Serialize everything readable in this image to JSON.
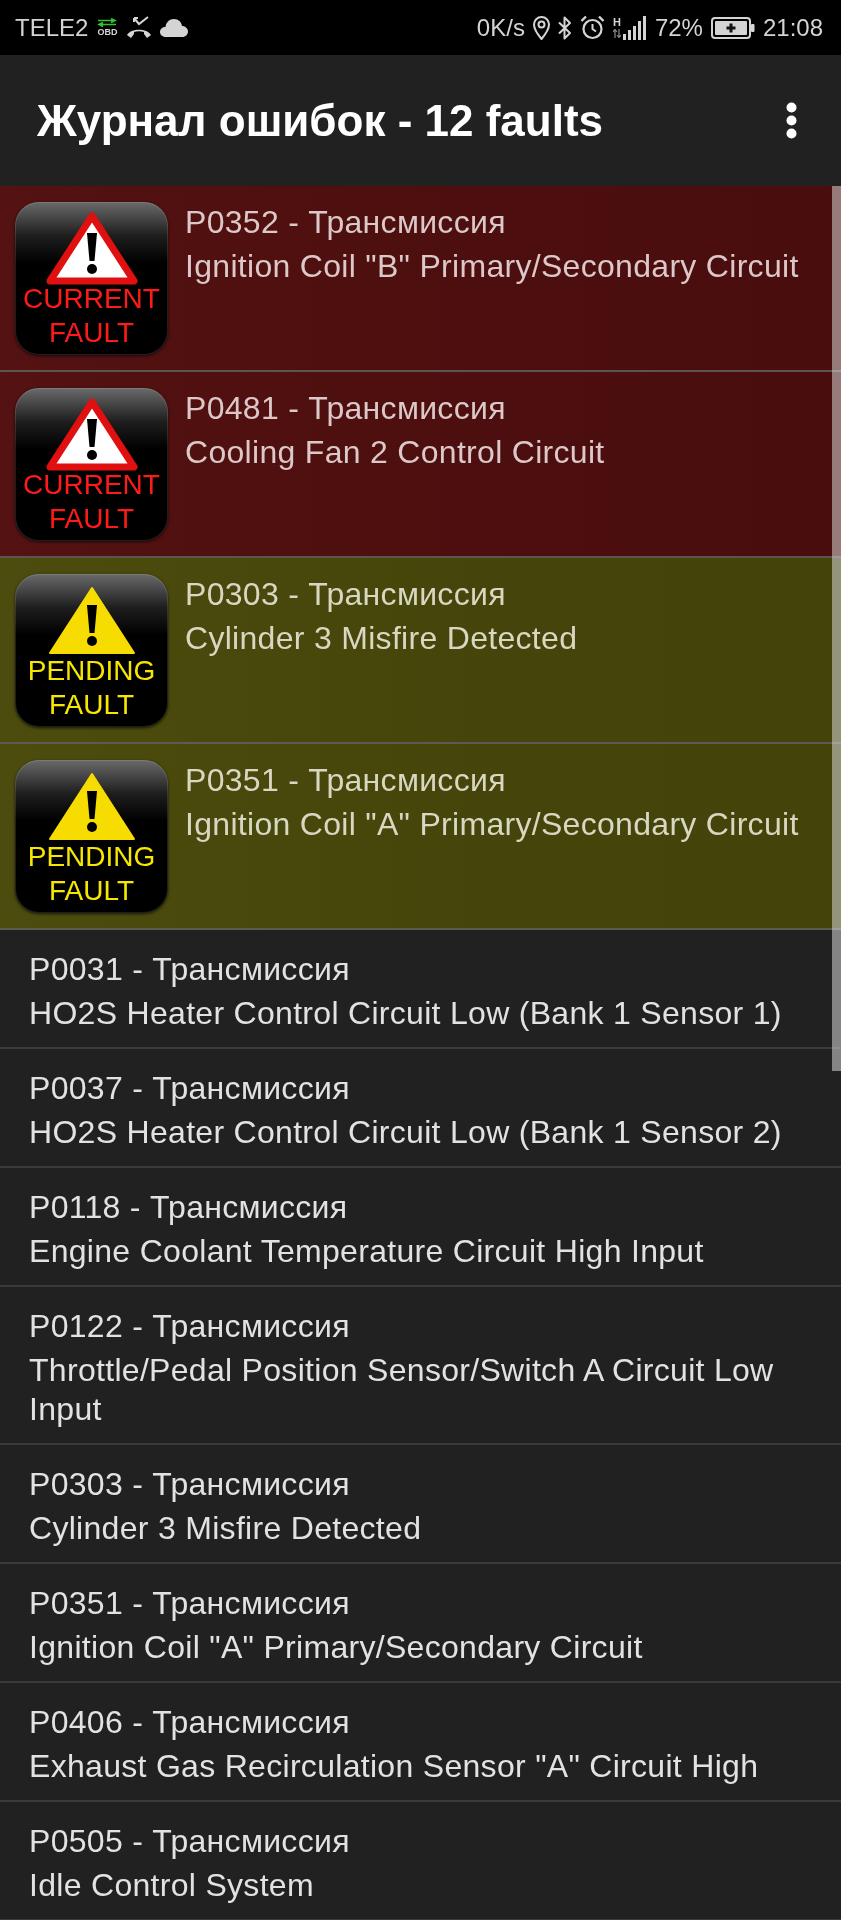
{
  "status_bar": {
    "carrier": "TELE2",
    "notification_label": "OBD",
    "speed": "0K/s",
    "network_type": "H",
    "battery": "72%",
    "time": "21:08"
  },
  "app_bar": {
    "title": "Журнал ошибок - 12 faults"
  },
  "faults": [
    {
      "kind": "current",
      "badge": "CURRENT FAULT",
      "code": "P0352 - Трансмиссия",
      "description": "Ignition Coil \"B\" Primary/Secondary Circuit"
    },
    {
      "kind": "current",
      "badge": "CURRENT FAULT",
      "code": "P0481 - Трансмиссия",
      "description": "Cooling Fan 2 Control Circuit"
    },
    {
      "kind": "pending",
      "badge": "PENDING FAULT",
      "code": "P0303 - Трансмиссия",
      "description": "Cylinder 3 Misfire Detected"
    },
    {
      "kind": "pending",
      "badge": "PENDING FAULT",
      "code": "P0351 - Трансмиссия",
      "description": "Ignition Coil \"A\" Primary/Secondary Circuit"
    },
    {
      "kind": "stored",
      "code": "P0031 - Трансмиссия",
      "description": "HO2S Heater Control Circuit Low (Bank 1 Sensor 1)"
    },
    {
      "kind": "stored",
      "code": "P0037 - Трансмиссия",
      "description": "HO2S Heater Control Circuit Low (Bank 1 Sensor 2)"
    },
    {
      "kind": "stored",
      "code": "P0118 - Трансмиссия",
      "description": "Engine Coolant Temperature Circuit High Input"
    },
    {
      "kind": "stored",
      "code": "P0122 - Трансмиссия",
      "description": "Throttle/Pedal Position Sensor/Switch A Circuit Low Input"
    },
    {
      "kind": "stored",
      "code": "P0303 - Трансмиссия",
      "description": "Cylinder 3 Misfire Detected"
    },
    {
      "kind": "stored",
      "code": "P0351 - Трансмиссия",
      "description": "Ignition Coil \"A\" Primary/Secondary Circuit"
    },
    {
      "kind": "stored",
      "code": "P0406 - Трансмиссия",
      "description": "Exhaust Gas Recirculation Sensor \"A\" Circuit High"
    },
    {
      "kind": "stored",
      "code": "P0505 - Трансмиссия",
      "description": "Idle Control System"
    }
  ]
}
